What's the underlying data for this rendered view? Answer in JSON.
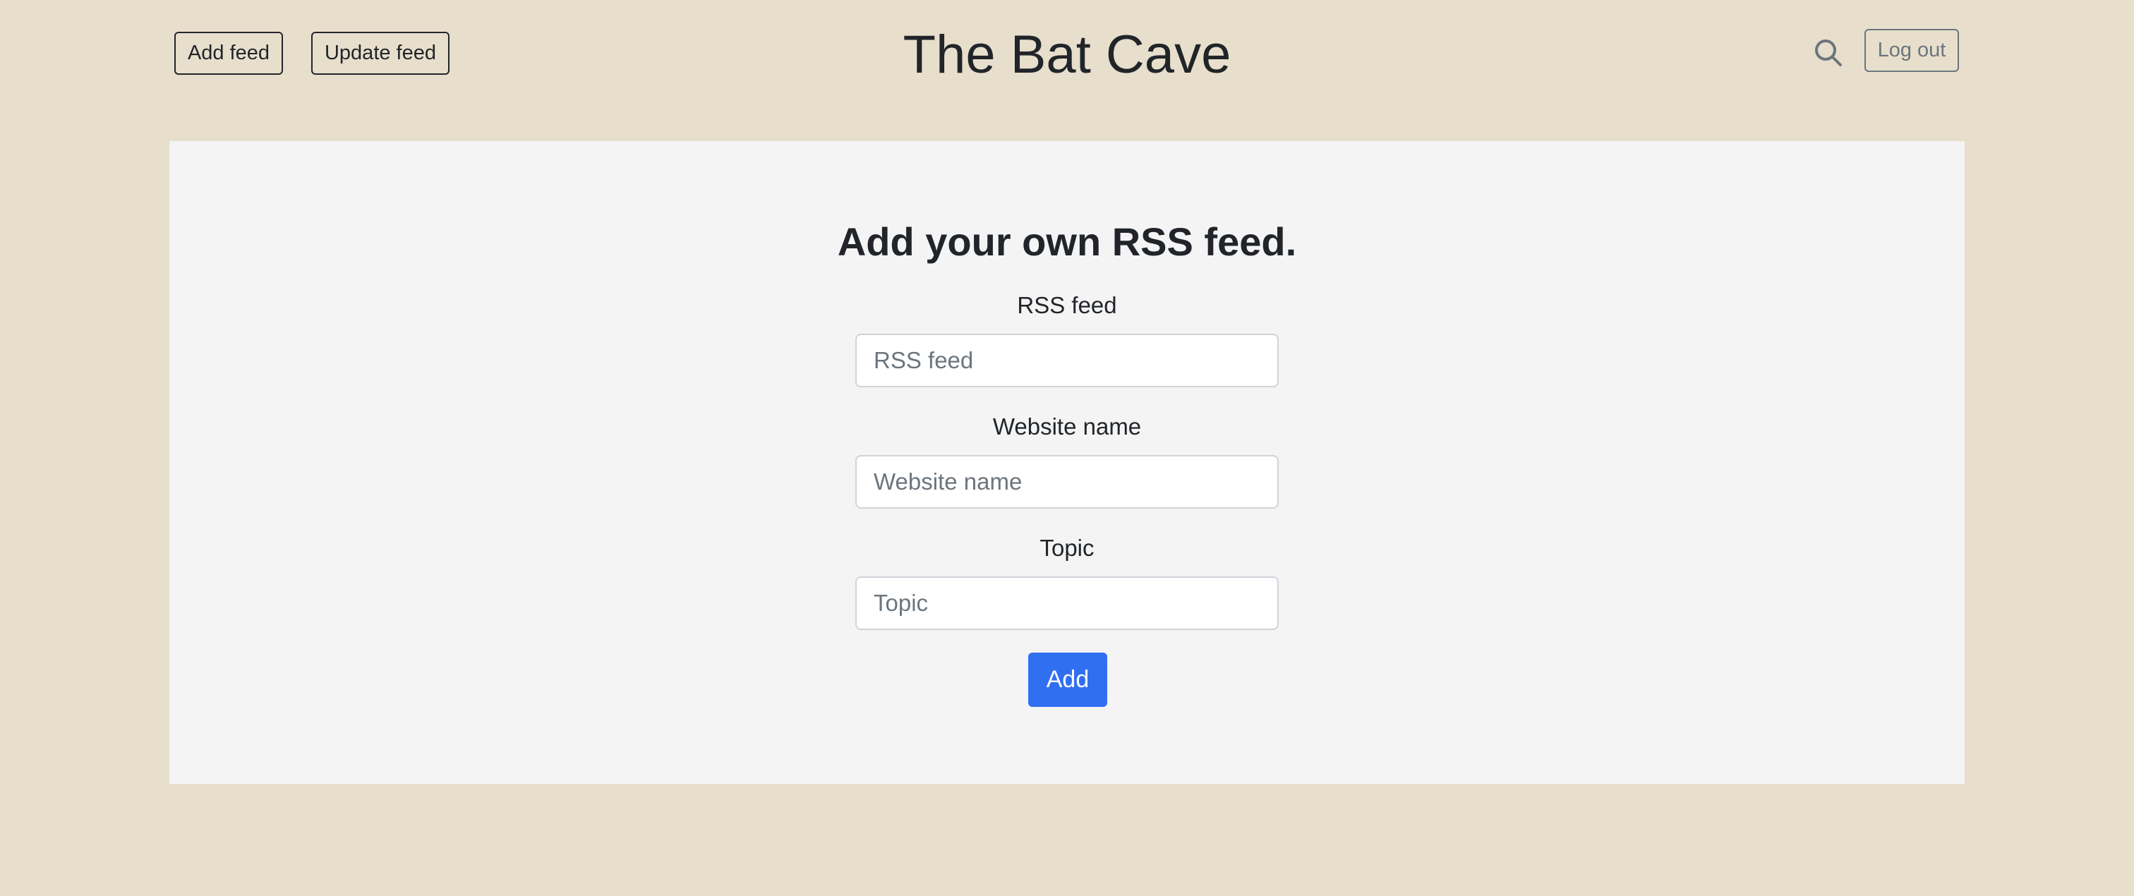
{
  "header": {
    "title": "The Bat Cave",
    "add_feed_label": "Add feed",
    "update_feed_label": "Update feed",
    "logout_label": "Log out",
    "search_icon": "search-icon"
  },
  "form": {
    "title": "Add your own RSS feed.",
    "fields": [
      {
        "label": "RSS feed",
        "placeholder": "RSS feed",
        "value": ""
      },
      {
        "label": "Website name",
        "placeholder": "Website name",
        "value": ""
      },
      {
        "label": "Topic",
        "placeholder": "Topic",
        "value": ""
      }
    ],
    "submit_label": "Add"
  },
  "colors": {
    "page_background": "#e7dfcc",
    "panel_background": "#f4f4f4",
    "primary": "#316ff1",
    "text": "#212529",
    "muted": "#6c757d"
  }
}
